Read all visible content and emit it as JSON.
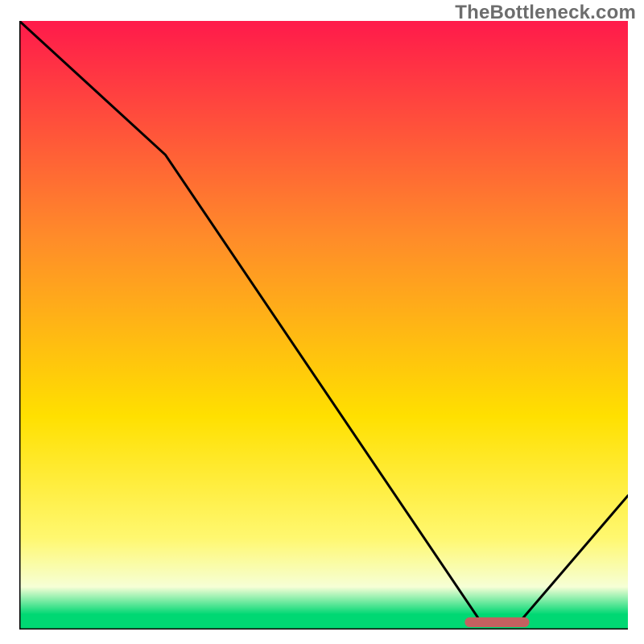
{
  "watermark": "TheBottleneck.com",
  "colors": {
    "gradient_top": "#ff1a4b",
    "gradient_mid1": "#ff8a2a",
    "gradient_mid2": "#ffe000",
    "gradient_mid3": "#fff870",
    "gradient_bottom_pale": "#f6ffd6",
    "gradient_green": "#00d873",
    "line": "#000000",
    "axis": "#000000",
    "marker": "#c46060"
  },
  "chart_data": {
    "type": "line",
    "title": "",
    "xlabel": "",
    "ylabel": "",
    "xlim": [
      0,
      100
    ],
    "ylim": [
      0,
      100
    ],
    "grid": false,
    "legend_position": "none",
    "series": [
      {
        "name": "curve",
        "x": [
          0,
          24,
          76,
          82,
          100
        ],
        "y": [
          100,
          78,
          1,
          1,
          22
        ]
      }
    ],
    "marker": {
      "x_range": [
        74,
        83
      ],
      "y": 1.2,
      "thickness": 1.2
    }
  }
}
